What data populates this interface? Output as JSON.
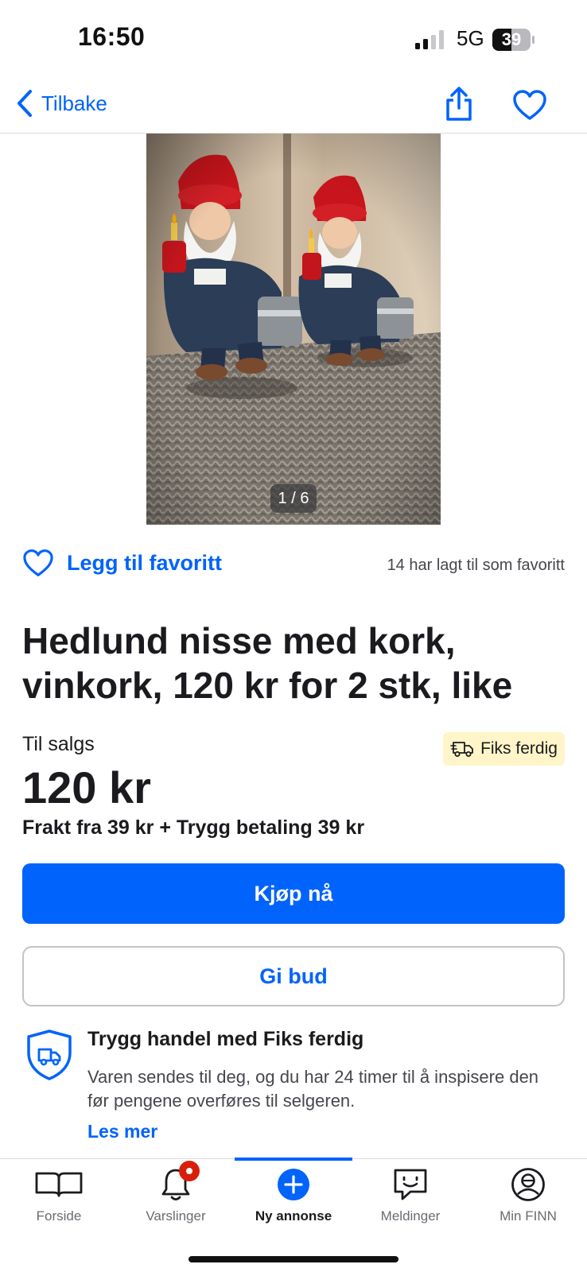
{
  "status_bar": {
    "time": "16:50",
    "network": "5G",
    "battery": "39"
  },
  "nav": {
    "back_label": "Tilbake"
  },
  "gallery": {
    "counter": "1 / 6"
  },
  "favorite": {
    "label": "Legg til favoritt",
    "count_text": "14 har lagt til som favoritt"
  },
  "listing": {
    "title": "Hedlund nisse med kork, vinkork, 120 kr for 2 stk, like",
    "sale_label": "Til salgs",
    "price": "120 kr",
    "badge": "Fiks ferdig",
    "shipping": "Frakt fra 39 kr + Trygg betaling 39 kr"
  },
  "actions": {
    "buy_label": "Kjøp nå",
    "bid_label": "Gi bud"
  },
  "safe_trade": {
    "title": "Trygg handel med Fiks ferdig",
    "body": "Varen sendes til deg, og du har 24 timer til å inspisere den før pengene overføres til selgeren.",
    "link": "Les mer"
  },
  "tabbar": {
    "items": [
      {
        "label": "Forside",
        "icon": "book-icon"
      },
      {
        "label": "Varslinger",
        "icon": "bell-icon"
      },
      {
        "label": "Ny annonse",
        "icon": "plus-circle-icon"
      },
      {
        "label": "Meldinger",
        "icon": "chat-icon"
      },
      {
        "label": "Min FINN",
        "icon": "profile-icon"
      }
    ],
    "active_index": 2
  },
  "colors": {
    "accent": "#0063fb",
    "badge_bg": "#fff5c8",
    "notification": "#d91f0a"
  }
}
